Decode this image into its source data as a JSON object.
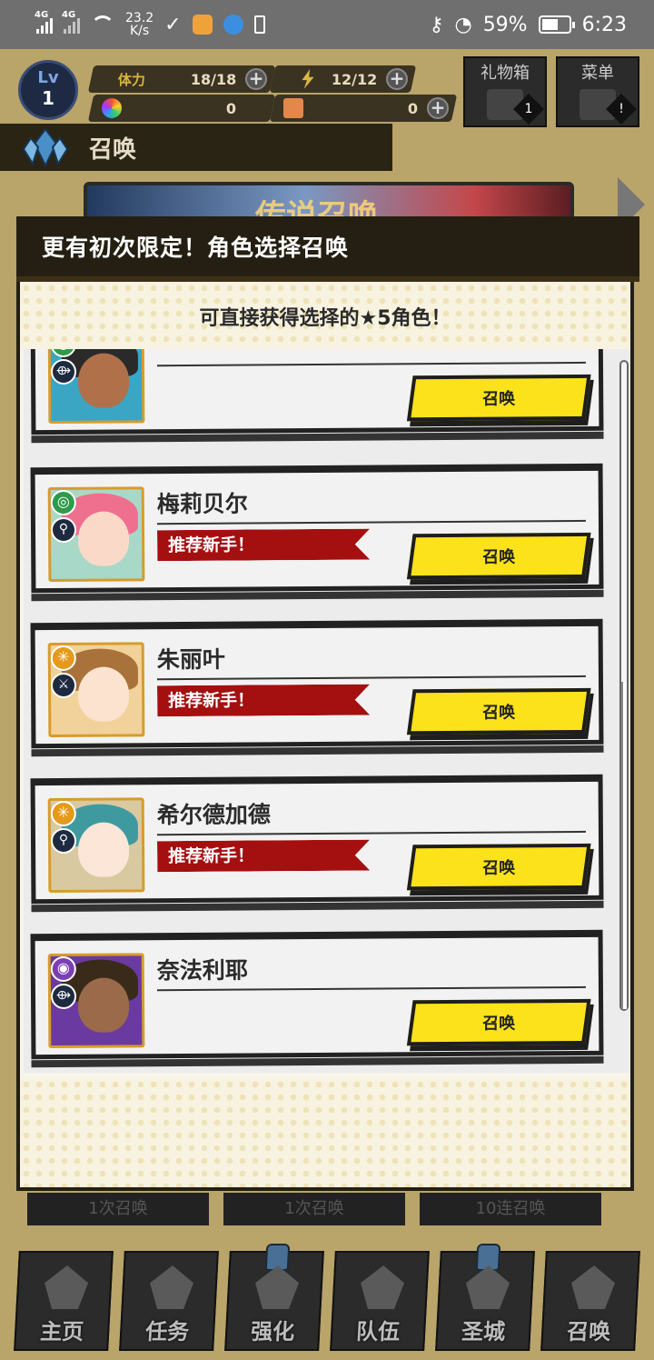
{
  "status_bar": {
    "signal1": "4G",
    "signal2": "4G",
    "net_speed": "23.2",
    "net_unit": "K/s",
    "battery_pct": "59%",
    "time": "6:23"
  },
  "hud": {
    "lv_label": "Lv",
    "level": "1",
    "stamina_label": "体力",
    "stamina": "18/18",
    "energy": "12/12",
    "gems": "0",
    "tickets": "0",
    "gift_box_label": "礼物箱",
    "gift_count": "1",
    "menu_label": "菜单",
    "menu_badge": "!",
    "section_title": "召唤"
  },
  "background": {
    "banner_text": "传说召唤"
  },
  "modal": {
    "title": "更有初次限定！角色选择召唤",
    "subtitle": "可直接获得选择的★5角色！",
    "items": [
      {
        "name": "",
        "recommended": false,
        "ribbon": "",
        "button": "召唤",
        "element_color": "#2f9a4a",
        "role_icon": "⟴"
      },
      {
        "name": "梅莉贝尔",
        "recommended": true,
        "ribbon": "推荐新手！",
        "button": "召唤",
        "element_color": "#2f9a4a",
        "role_icon": "⚲"
      },
      {
        "name": "朱丽叶",
        "recommended": true,
        "ribbon": "推荐新手！",
        "button": "召唤",
        "element_color": "#e59a1c",
        "role_icon": "⚔"
      },
      {
        "name": "希尔德加德",
        "recommended": true,
        "ribbon": "推荐新手！",
        "button": "召唤",
        "element_color": "#e59a1c",
        "role_icon": "⚲"
      },
      {
        "name": "奈法利耶",
        "recommended": false,
        "ribbon": "",
        "button": "召唤",
        "element_color": "#7b3fb5",
        "role_icon": "⟴"
      }
    ]
  },
  "peek_tabs": [
    "1次召唤",
    "1次召唤",
    "10连召唤"
  ],
  "bottom_nav": [
    {
      "label": "主页",
      "locked": false
    },
    {
      "label": "任务",
      "locked": false
    },
    {
      "label": "强化",
      "locked": true
    },
    {
      "label": "队伍",
      "locked": false
    },
    {
      "label": "圣城",
      "locked": true
    },
    {
      "label": "召唤",
      "locked": false
    }
  ]
}
